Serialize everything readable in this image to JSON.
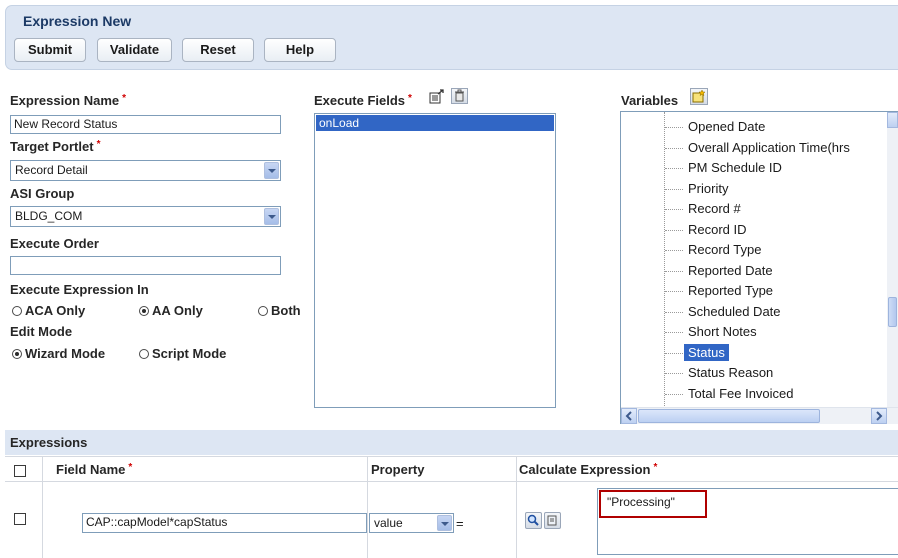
{
  "header": {
    "title": "Expression New",
    "buttons": {
      "submit": "Submit",
      "validate": "Validate",
      "reset": "Reset",
      "help": "Help"
    }
  },
  "form": {
    "expression_name_label": "Expression Name",
    "required_mark": "*",
    "expression_name_value": "New Record Status",
    "target_portlet_label": "Target Portlet",
    "target_portlet_value": "Record Detail",
    "asi_group_label": "ASI Group",
    "asi_group_value": "BLDG_COM",
    "execute_order_label": "Execute Order",
    "execute_order_value": "",
    "execute_in_label": "Execute Expression In",
    "execute_in_options": [
      "ACA Only",
      "AA Only",
      "Both"
    ],
    "execute_in_selected": "AA Only",
    "edit_mode_label": "Edit Mode",
    "edit_mode_options": [
      "Wizard Mode",
      "Script Mode"
    ],
    "edit_mode_selected": "Wizard Mode"
  },
  "execute_fields": {
    "label": "Execute Fields",
    "items": [
      "onLoad"
    ],
    "selected": "onLoad"
  },
  "variables": {
    "label": "Variables",
    "items": [
      "Opened Date",
      "Overall Application Time(hrs",
      "PM Schedule ID",
      "Priority",
      "Record #",
      "Record ID",
      "Record Type",
      "Reported Date",
      "Reported Type",
      "Scheduled Date",
      "Short Notes",
      "Status",
      "Status Reason",
      "Total Fee Invoiced"
    ],
    "selected": "Status"
  },
  "expressions": {
    "section_label": "Expressions",
    "columns": {
      "field_name": "Field Name",
      "property": "Property",
      "calculate": "Calculate Expression"
    },
    "rows": [
      {
        "field_name": "CAP::capModel*capStatus",
        "property": "value",
        "operator": "=",
        "calculate": "\"Processing\""
      }
    ]
  },
  "colors": {
    "accent": "#3166c5",
    "header_bg": "#dde6f3",
    "highlight_box": "#b00000"
  },
  "icons": [
    "export-icon",
    "delete-icon",
    "add-variable-icon",
    "search-icon",
    "edit-icon"
  ]
}
